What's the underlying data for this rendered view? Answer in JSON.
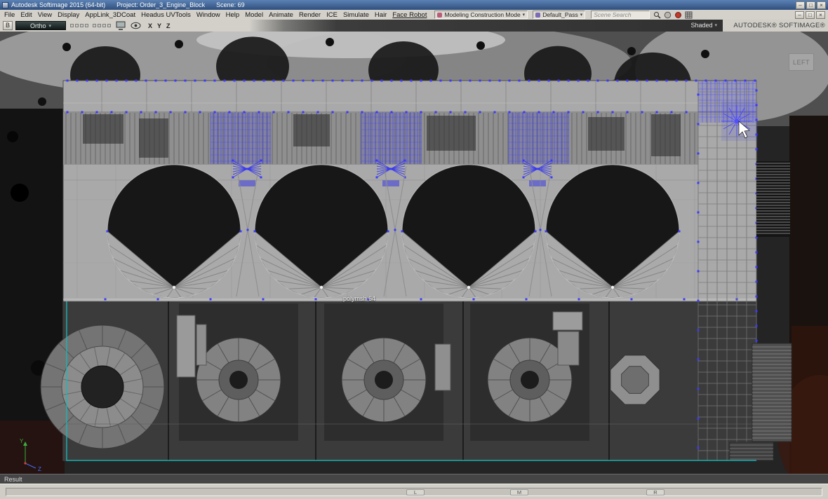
{
  "window": {
    "title": "Autodesk Softimage 2015 (64-bit)",
    "project": "Project: Order_3_Engine_Block",
    "scene": "Scene: 69",
    "brand": "AUTODESK® SOFTIMAGE®"
  },
  "menus": [
    "File",
    "Edit",
    "View",
    "Display",
    "AppLink_3DCoat",
    "Headus UVTools",
    "Window",
    "Help",
    "Model",
    "Animate",
    "Render",
    "ICE",
    "Simulate",
    "Hair",
    "Face Robot"
  ],
  "toolbar": {
    "construction_mode": "Modeling Construction Mode",
    "pass_name": "Default_Pass",
    "search_placeholder": "Scene Search"
  },
  "viewport_header": {
    "b_button": "B",
    "view_type": "Ortho",
    "axis_x": "X",
    "axis_y": "Y",
    "axis_z": "Z",
    "shading_mode": "Shaded"
  },
  "viewport": {
    "view_label": "LEFT",
    "mesh_label": "polymsh 64",
    "axis_y": "Y",
    "axis_z": "Z"
  },
  "status_bar": {
    "message": "Result"
  },
  "bottom_bar": {
    "left": "L",
    "middle": "M",
    "right": "R"
  },
  "icons": {
    "minimize": "–",
    "maximize": "□",
    "close": "×",
    "dropdown_arrow": "▾"
  },
  "colors": {
    "selection_blue": "#3a3aff",
    "teal_edge": "#1ab8b8",
    "axis_green": "#3fae3f",
    "axis_blue": "#4a6cff"
  }
}
